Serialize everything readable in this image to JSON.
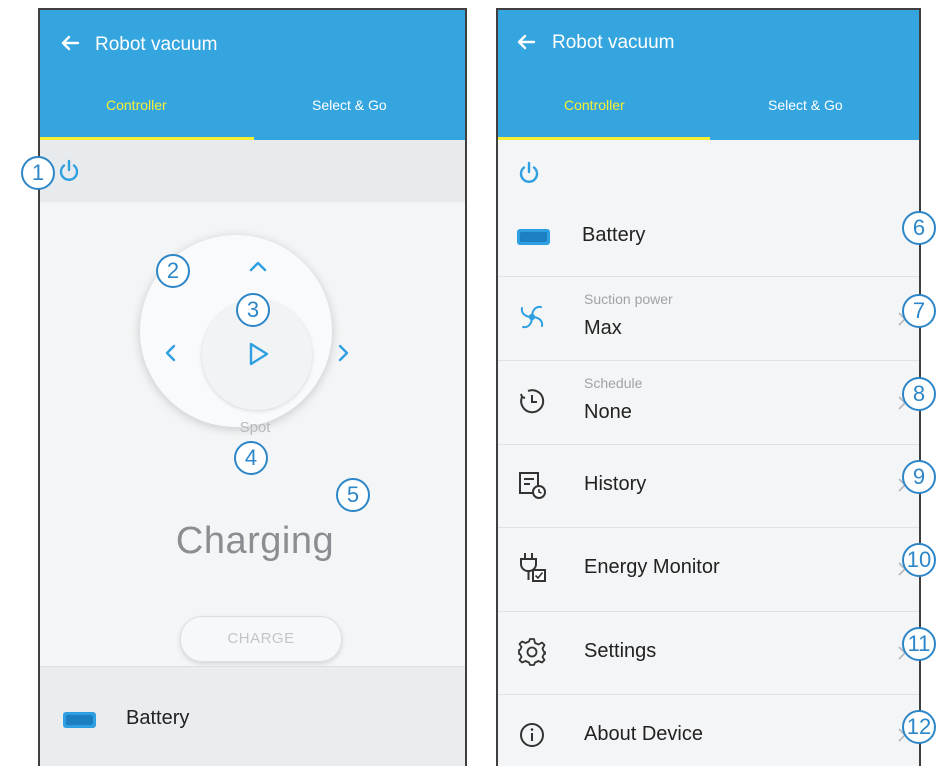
{
  "left_screen": {
    "app_title": "Robot vacuum",
    "tabs": [
      {
        "label": "Controller",
        "active": true
      },
      {
        "label": "Select & Go",
        "active": false
      }
    ],
    "dial": {
      "center_icon": "play-icon",
      "spot_label": "Spot"
    },
    "status": "Charging",
    "charge_button": "CHARGE",
    "bottom_row": {
      "label": "Battery",
      "icon": "battery-icon"
    }
  },
  "right_screen": {
    "app_title": "Robot vacuum",
    "tabs": [
      {
        "label": "Controller",
        "active": true
      },
      {
        "label": "Select & Go",
        "active": false
      }
    ],
    "rows": [
      {
        "label": "Battery",
        "sublabel": "",
        "icon": "battery-icon"
      },
      {
        "label": "Max",
        "sublabel": "Suction power",
        "icon": "fan-icon"
      },
      {
        "label": "None",
        "sublabel": "Schedule",
        "icon": "clock-icon"
      },
      {
        "label": "History",
        "sublabel": "",
        "icon": "history-icon"
      },
      {
        "label": "Energy Monitor",
        "sublabel": "",
        "icon": "plug-icon"
      },
      {
        "label": "Settings",
        "sublabel": "",
        "icon": "gear-icon"
      },
      {
        "label": "About Device",
        "sublabel": "",
        "icon": "info-icon"
      }
    ]
  },
  "callouts": [
    "1",
    "2",
    "3",
    "4",
    "5",
    "6",
    "7",
    "8",
    "9",
    "10",
    "11",
    "12"
  ],
  "colors": {
    "appbar": "#34a5df",
    "tab_active": "#f7ef36",
    "icon_blue": "#2e9fe0",
    "callout": "#2d86c8",
    "row_text": "#222222"
  }
}
